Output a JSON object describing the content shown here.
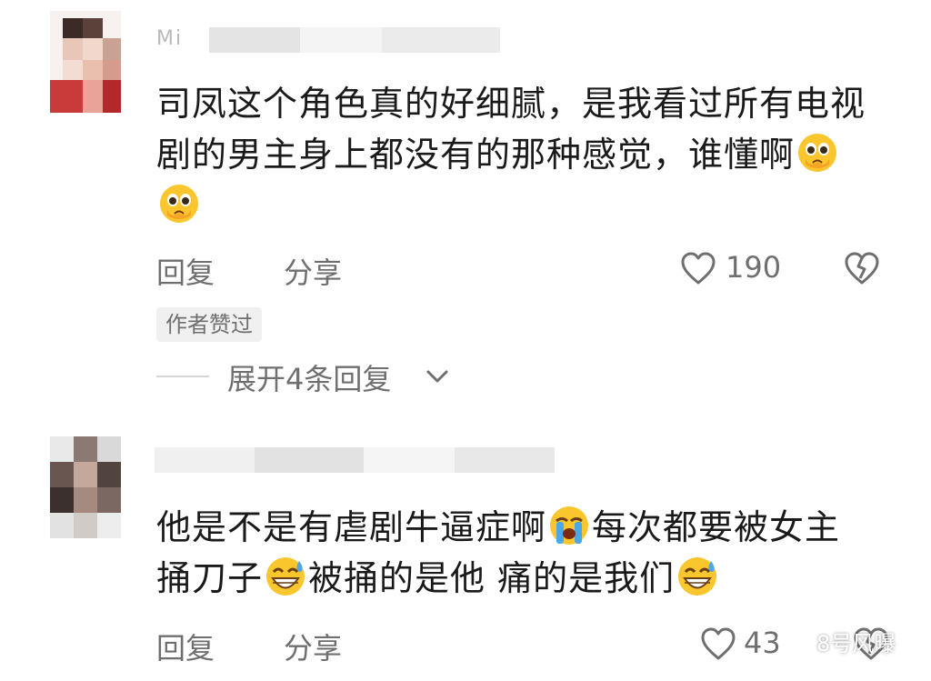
{
  "comments": [
    {
      "username": "Mi",
      "text_prefix": "司凤这个角色真的好细腻，是我看过所有电视剧的男主身上都没有的那种感觉，谁懂啊",
      "emojis": [
        "pleading-crying-emoji",
        "pleading-crying-emoji"
      ],
      "reply_label": "回复",
      "share_label": "分享",
      "like_count": "190",
      "author_liked": "作者赞过",
      "expand_replies": "展开4条回复"
    },
    {
      "text_part1": "他是不是有虐剧牛逼症啊",
      "text_part2": "每次都要被女主捅刀子",
      "text_part3": "被捅的是他 痛的是我们",
      "emojis": [
        "loudly-crying-emoji",
        "grinning-sweat-emoji",
        "grinning-sweat-emoji"
      ],
      "reply_label": "回复",
      "share_label": "分享",
      "like_count": "43"
    }
  ],
  "watermark": "8号风曝",
  "icons": {
    "like": "heart-outline-icon",
    "dislike": "broken-heart-icon",
    "expand": "chevron-down-icon",
    "watermark": "wechat-icon"
  },
  "colors": {
    "text": "#1a1a1a",
    "secondary": "#6f6f6f",
    "badge_bg": "#f0f0f0",
    "emoji_yellow": "#f9c62e"
  }
}
